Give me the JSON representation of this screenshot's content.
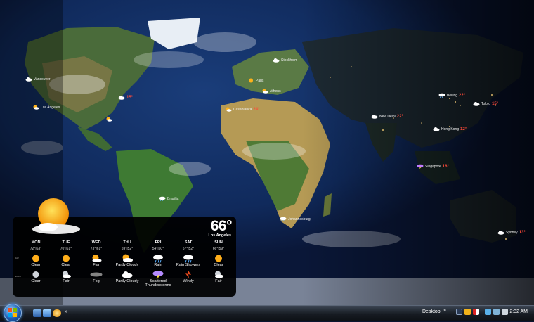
{
  "map_cities": [
    {
      "name": "Vancouver",
      "temp": "",
      "icon": "cloudy-icon"
    },
    {
      "name": "Los Angeles",
      "temp": "",
      "icon": "partly-cloudy-icon"
    },
    {
      "name": "",
      "temp": "15°",
      "icon": "cloudy-icon"
    },
    {
      "name": "",
      "temp": "",
      "icon": "partly-cloudy-icon"
    },
    {
      "name": "Paris",
      "temp": "",
      "icon": "sunny-icon"
    },
    {
      "name": "Stockholm",
      "temp": "",
      "icon": "cloudy-icon"
    },
    {
      "name": "Casablanca",
      "temp": "24°",
      "icon": "partly-cloudy-icon"
    },
    {
      "name": "Athens",
      "temp": "",
      "icon": "partly-cloudy-icon"
    },
    {
      "name": "New Delhi",
      "temp": "22°",
      "icon": "cloudy-icon"
    },
    {
      "name": "Beijing",
      "temp": "22°",
      "icon": "rain-icon"
    },
    {
      "name": "Tokyo",
      "temp": "15°",
      "icon": "cloudy-icon"
    },
    {
      "name": "Hong Kong",
      "temp": "12°",
      "icon": "cloudy-icon"
    },
    {
      "name": "Singapore",
      "temp": "16°",
      "icon": "thunderstorm-icon"
    },
    {
      "name": "Brasilia",
      "temp": "",
      "icon": "rain-icon"
    },
    {
      "name": "Johannesburg",
      "temp": "",
      "icon": "rain-icon"
    },
    {
      "name": "Sydney",
      "temp": "13°",
      "icon": "cloudy-icon"
    }
  ],
  "weather": {
    "current_temp": "66°",
    "current_city": "Los Angeles",
    "day_label": "DAY",
    "night_label": "NIGHT",
    "days": [
      {
        "name": "MON",
        "hilo": "72°|63°",
        "day_cond": "Clear",
        "day_icon": "sun-icon",
        "night_cond": "Clear",
        "night_icon": "moon-icon"
      },
      {
        "name": "TUE",
        "hilo": "70°|61°",
        "day_cond": "Clear",
        "day_icon": "sun-icon",
        "night_cond": "Fair",
        "night_icon": "moon-cloud-icon"
      },
      {
        "name": "WED",
        "hilo": "73°|61°",
        "day_cond": "Fair",
        "day_icon": "sun-cloud-icon",
        "night_cond": "Fog",
        "night_icon": "fog-icon"
      },
      {
        "name": "THU",
        "hilo": "59°|52°",
        "day_cond": "Partly Cloudy",
        "day_icon": "sun-cloud-icon",
        "night_cond": "Partly Cloudy",
        "night_icon": "cloud-icon"
      },
      {
        "name": "FRI",
        "hilo": "54°|50°",
        "day_cond": "Rain",
        "day_icon": "rain-icon",
        "night_cond": "Scattered Thunderstorms",
        "night_icon": "thunderstorm-icon"
      },
      {
        "name": "SAT",
        "hilo": "57°|52°",
        "day_cond": "Rain Showers",
        "day_icon": "rain-icon",
        "night_cond": "Windy",
        "night_icon": "windy-icon"
      },
      {
        "name": "SUN",
        "hilo": "66°|59°",
        "day_cond": "Clear",
        "day_icon": "sun-icon",
        "night_cond": "Fair",
        "night_icon": "moon-cloud-icon"
      }
    ]
  },
  "taskbar": {
    "desktop_label": "Desktop",
    "chevron": "»",
    "clock": "2:32 AM"
  }
}
